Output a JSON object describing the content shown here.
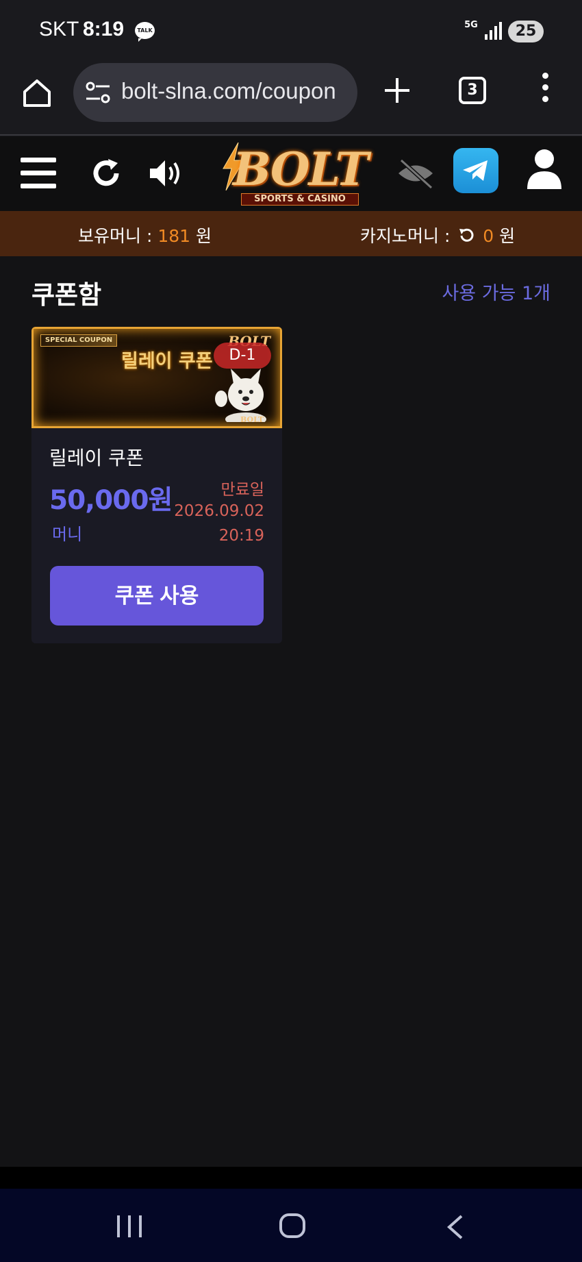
{
  "status_bar": {
    "carrier": "SKT",
    "time": "8:19",
    "talk_badge": "TALK",
    "network": "5G",
    "battery": "25"
  },
  "browser": {
    "url": "bolt-slna.com/coupon",
    "tab_count": "3"
  },
  "site_header": {
    "logo_text": "BOLT",
    "logo_subtitle": "SPORTS & CASINO"
  },
  "balance": {
    "holding_label": "보유머니 :",
    "holding_value": "181",
    "holding_unit": "원",
    "casino_label": "카지노머니 :",
    "casino_value": "0",
    "casino_unit": "원"
  },
  "page": {
    "title": "쿠폰함",
    "available_count": "사용 가능 1개"
  },
  "coupons": [
    {
      "banner_tag": "SPECIAL COUPON",
      "banner_title": "릴레이 쿠폰",
      "banner_logo": "BOLT",
      "banner_logo_small": "BOLT",
      "dday": "D-1",
      "name": "릴레이 쿠폰",
      "amount": "50,000원",
      "type": "머니",
      "expire_label": "만료일",
      "expire_date": "2026.09.02",
      "expire_time": "20:19",
      "use_button_label": "쿠폰 사용"
    }
  ],
  "colors": {
    "background": "#131315",
    "balance_bar": "#4a250f",
    "accent_orange": "#f08a24",
    "accent_purple": "#6656da",
    "amount_text": "#6a6aee",
    "expire_text": "#d9635a"
  }
}
